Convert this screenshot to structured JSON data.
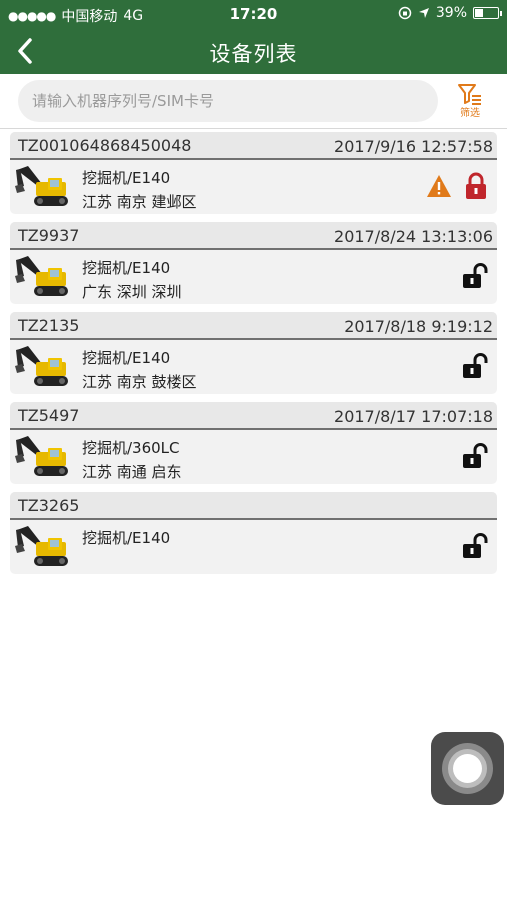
{
  "status_bar": {
    "carrier": "中国移动",
    "network": "4G",
    "time": "17:20",
    "battery": "39%",
    "battery_level": 0.39
  },
  "nav": {
    "title": "设备列表"
  },
  "search": {
    "placeholder": "请输入机器序列号/SIM卡号",
    "filter_label": "筛选"
  },
  "colors": {
    "header_green": "#2f6e3b",
    "accent_orange": "#e07a1a",
    "lock_red": "#c0262c"
  },
  "devices": [
    {
      "id": "TZ001064868450048",
      "time": "2017/9/16 12:57:58",
      "model": "挖掘机/E140",
      "location": "江苏 南京 建邺区",
      "warning": true,
      "lock": "locked"
    },
    {
      "id": "TZ9937",
      "time": "2017/8/24 13:13:06",
      "model": "挖掘机/E140",
      "location": "广东 深圳 深圳",
      "warning": false,
      "lock": "unlocked"
    },
    {
      "id": "TZ2135",
      "time": "2017/8/18 9:19:12",
      "model": "挖掘机/E140",
      "location": "江苏 南京 鼓楼区",
      "warning": false,
      "lock": "unlocked"
    },
    {
      "id": "TZ5497",
      "time": "2017/8/17 17:07:18",
      "model": "挖掘机/360LC",
      "location": "江苏 南通 启东",
      "warning": false,
      "lock": "unlocked"
    },
    {
      "id": "TZ3265",
      "time": "",
      "model": "挖掘机/E140",
      "location": "",
      "warning": false,
      "lock": "unlocked"
    }
  ]
}
